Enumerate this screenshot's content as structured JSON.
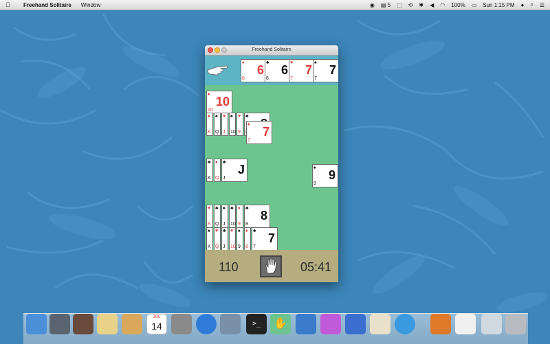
{
  "menubar": {
    "app_name": "Freehand Solitaire",
    "menu_window": "Window",
    "status": {
      "adobe_count": "5",
      "battery": "100%",
      "clock": "Sun 1:15 PM"
    }
  },
  "window": {
    "title": "Freehand Solitaire"
  },
  "game": {
    "score": "110",
    "timer": "05:41"
  },
  "cards": {
    "foundation": [
      {
        "rank": "6",
        "suit": "♦"
      },
      {
        "rank": "6",
        "suit": "♣"
      },
      {
        "rank": "7",
        "suit": "♥"
      },
      {
        "rank": "7",
        "suit": "♠"
      }
    ],
    "row1": [
      {
        "rank": "10",
        "suit": "♦"
      }
    ],
    "row2": [
      {
        "rank": "K",
        "suit": "♦"
      },
      {
        "rank": "Q",
        "suit": "♠"
      },
      {
        "rank": "J",
        "suit": "♥"
      },
      {
        "rank": "10",
        "suit": "♠"
      },
      {
        "rank": "9",
        "suit": "♥"
      },
      {
        "rank": "8",
        "suit": "♣"
      }
    ],
    "row2_loose": {
      "rank": "7",
      "suit": "♦"
    },
    "row3": [
      {
        "rank": "K",
        "suit": "♣"
      },
      {
        "rank": "Q",
        "suit": "♦"
      },
      {
        "rank": "J",
        "suit": "♣"
      }
    ],
    "row3_loose": {
      "rank": "9",
      "suit": "♠"
    },
    "row4": [
      {
        "rank": "K",
        "suit": "♥"
      },
      {
        "rank": "Q",
        "suit": "♣"
      },
      {
        "rank": "J",
        "suit": "♠"
      },
      {
        "rank": "10",
        "suit": "♣"
      },
      {
        "rank": "9",
        "suit": "♦"
      },
      {
        "rank": "8",
        "suit": "♣"
      }
    ],
    "row5": [
      {
        "rank": "K",
        "suit": "♠"
      },
      {
        "rank": "Q",
        "suit": "♥"
      },
      {
        "rank": "J",
        "suit": "♣"
      },
      {
        "rank": "10",
        "suit": "♥"
      },
      {
        "rank": "9",
        "suit": "♠"
      },
      {
        "rank": "8",
        "suit": "♦"
      },
      {
        "rank": "7",
        "suit": "♣"
      }
    ]
  },
  "dock": {
    "calendar_month": "JUL",
    "calendar_day": "14",
    "items": [
      "finder-icon",
      "launchpad-icon",
      "photo-booth-icon",
      "stickies-icon",
      "contacts-icon",
      "calendar-icon",
      "system-preferences-icon",
      "app-store-icon",
      "preview-icon",
      "terminal-icon",
      "freehand-solitaire-icon",
      "xcode-icon",
      "game-center-icon",
      "keynote-icon",
      "textedit-icon",
      "safari-icon",
      "garageband-icon",
      "documents-stack-icon",
      "finder-window-icon",
      "trash-icon"
    ]
  },
  "colors": {
    "felt": "#6cc58e",
    "top_strip": "#5db4c5",
    "bottom_bar": "#b5ad7f",
    "wallpaper": "#3c86ba",
    "red_suit": "#e23b3b"
  }
}
